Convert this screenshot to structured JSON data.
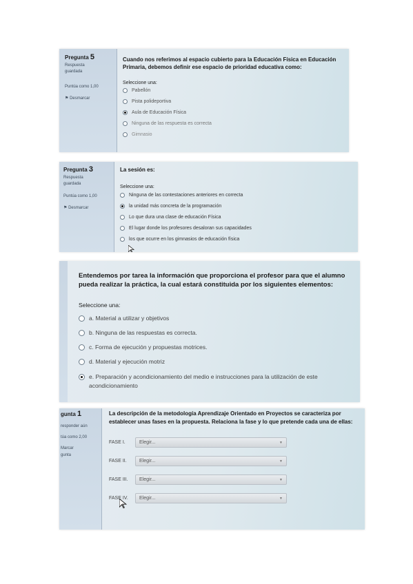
{
  "photo1": {
    "question_label": "Pregunta",
    "question_number": "5",
    "status": "Respuesta guardada",
    "points": "Puntúa como 1,00",
    "flag": "Desmarcar",
    "question_text": "Cuando nos referimos al espacio cubierto para la Educación Física en Educación Primaria, debemos definir ese espacio de prioridad educativa como:",
    "prompt": "Seleccione una:",
    "options": [
      {
        "label": "Pabellón",
        "selected": false
      },
      {
        "label": "Pista polideportiva",
        "selected": false
      },
      {
        "label": "Aula de Educación Física",
        "selected": true
      },
      {
        "label": "Ninguna de las respuesta es correcta",
        "selected": false
      },
      {
        "label": "Gimnasio",
        "selected": false
      }
    ]
  },
  "photo2": {
    "question_label": "Pregunta",
    "question_number": "3",
    "status": "Respuesta guardada",
    "points": "Puntúa como 1,00",
    "flag": "Desmarcar",
    "question_text": "La sesión es:",
    "prompt": "Seleccione una:",
    "options": [
      {
        "label": "Ninguna de las contestaciones anteriores en correcta",
        "selected": false
      },
      {
        "label": "la unidad más concreta de la programación",
        "selected": true
      },
      {
        "label": "Lo que dura una clase de educación Física",
        "selected": false
      },
      {
        "label": "El lugar donde los profesores desaloran sus capacidades",
        "selected": false
      },
      {
        "label": "los que ocurre en los gimnasios de educación física",
        "selected": false
      }
    ]
  },
  "photo3": {
    "question_text": "Entendemos por tarea la información que proporciona el profesor para que el alumno pueda realizar la práctica, la cual estará constituida por los siguientes elementos:",
    "prompt": "Seleccione una:",
    "options": [
      {
        "label": "a. Material a utilizar y objetivos",
        "selected": false
      },
      {
        "label": "b. Ninguna de las respuestas es correcta.",
        "selected": false
      },
      {
        "label": "c. Forma de ejecución y propuestas motrices.",
        "selected": false
      },
      {
        "label": "d. Material y ejecución motriz",
        "selected": false
      },
      {
        "label": "e. Preparación y acondicionamiento del medio e instrucciones para la utilización de este acondicionamiento",
        "selected": true
      }
    ]
  },
  "photo4": {
    "question_label": "gunta",
    "question_number": "1",
    "status": "responder aún",
    "points": "túa como 2,00",
    "flag": "Marcar gunta",
    "question_text": "La descripción de la metodología Aprendizaje Orientado en Proyectos se caracteriza por establecer unas fases en la propuesta. Relaciona la fase y lo que pretende cada una de ellas:",
    "rows": [
      {
        "label": "FASE I.",
        "value": "Elegir..."
      },
      {
        "label": "FASE II.",
        "value": "Elegir..."
      },
      {
        "label": "FASE III.",
        "value": "Elegir..."
      },
      {
        "label": "FASE IV.",
        "value": "Elegir..."
      }
    ]
  },
  "icons": {
    "flag": "flag-icon",
    "cursor": "mouse-pointer-icon",
    "caret": "dropdown-caret-icon"
  },
  "colors": {
    "sidebar": "#c9d6e3",
    "panel": "#dfe9ee",
    "selected_radio": "#111111"
  }
}
